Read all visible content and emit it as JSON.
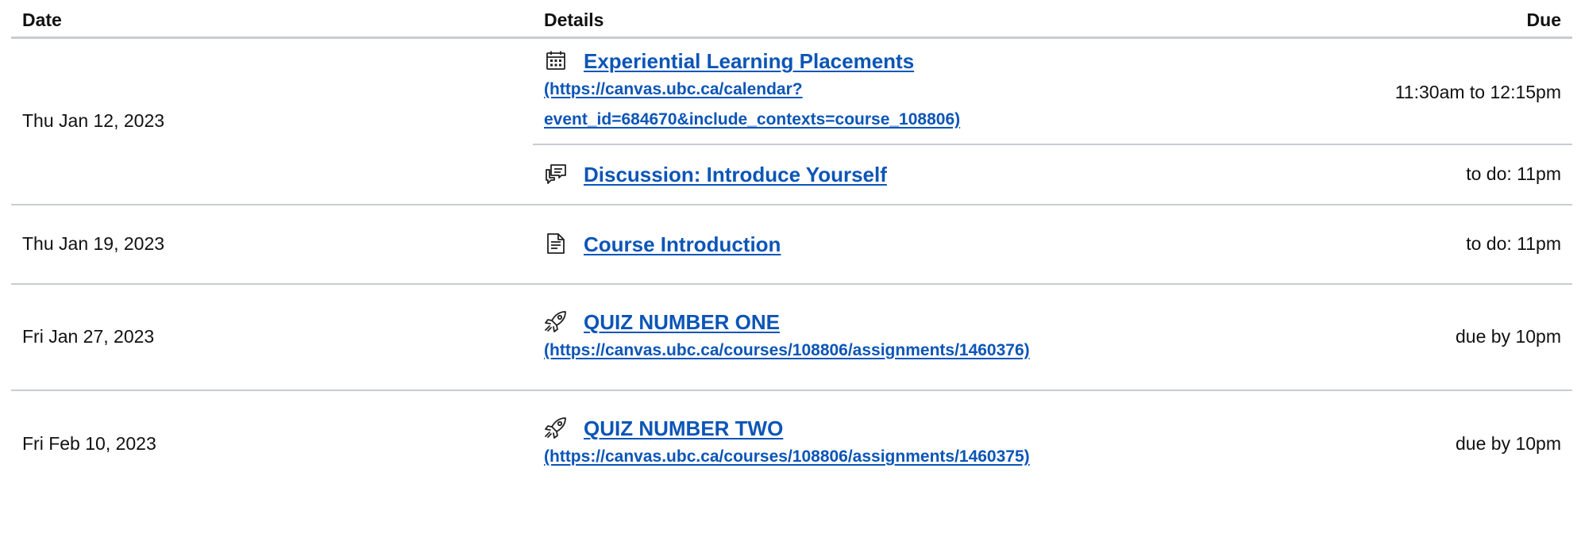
{
  "table": {
    "headers": {
      "date": "Date",
      "details": "Details",
      "due": "Due"
    },
    "rows": [
      {
        "date": "Thu Jan 12, 2023",
        "items": [
          {
            "icon": "calendar-icon",
            "title": "Experiential Learning Placements",
            "url_line1": "(https://canvas.ubc.ca/calendar?",
            "url_line2": "event_id=684670&include_contexts=course_108806)",
            "due": "11:30am to 12:15pm"
          },
          {
            "icon": "discussion-icon",
            "title": "Discussion: Introduce Yourself",
            "due": "to do: 11pm"
          }
        ]
      },
      {
        "date": "Thu Jan 19, 2023",
        "items": [
          {
            "icon": "document-icon",
            "title": "Course Introduction",
            "due": "to do: 11pm"
          }
        ]
      },
      {
        "date": "Fri Jan 27, 2023",
        "items": [
          {
            "icon": "quiz-rocket-icon",
            "title": "QUIZ NUMBER ONE",
            "url": "(https://canvas.ubc.ca/courses/108806/assignments/1460376)",
            "due": "due by 10pm"
          }
        ]
      },
      {
        "date": "Fri Feb 10, 2023",
        "items": [
          {
            "icon": "quiz-rocket-icon",
            "title": "QUIZ NUMBER TWO",
            "url": "(https://canvas.ubc.ca/courses/108806/assignments/1460375)",
            "due": "due by 10pm"
          }
        ]
      }
    ]
  },
  "colors": {
    "link": "#0b55b7",
    "divider": "#c7cdd1",
    "text": "#111111"
  }
}
